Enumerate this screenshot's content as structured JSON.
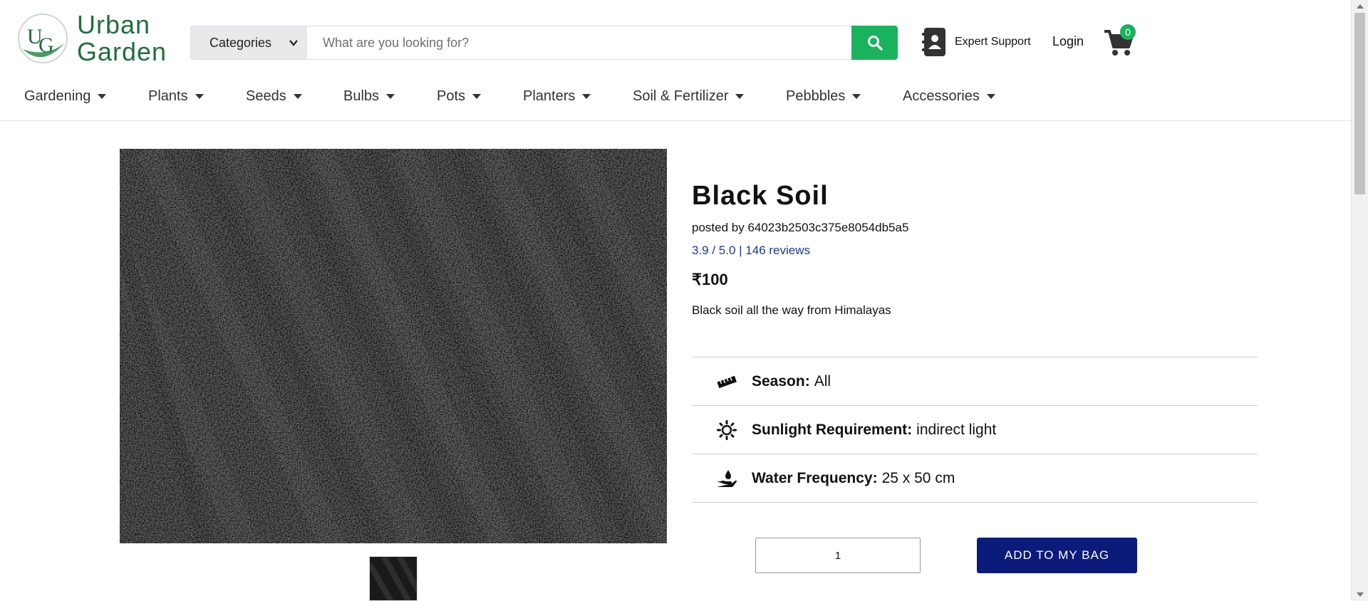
{
  "brand": {
    "line1": "Urban",
    "line2": "Garden",
    "color": "#1f6f3b"
  },
  "search": {
    "category_label": "Categories",
    "placeholder": "What are you looking for?",
    "button_icon": "search-icon",
    "button_color": "#1ab35d"
  },
  "header": {
    "support_label": "Expert Support",
    "login_label": "Login",
    "cart_count": "0"
  },
  "nav": {
    "items": [
      {
        "label": "Gardening"
      },
      {
        "label": "Plants"
      },
      {
        "label": "Seeds"
      },
      {
        "label": "Bulbs"
      },
      {
        "label": "Pots"
      },
      {
        "label": "Planters"
      },
      {
        "label": "Soil & Fertilizer"
      },
      {
        "label": "Pebbbles"
      },
      {
        "label": "Accessories"
      }
    ]
  },
  "product": {
    "title": "Black Soil",
    "posted_by": "posted by 64023b2503c375e8054db5a5",
    "rating_text": "3.9 / 5.0 | 146 reviews",
    "price": "₹100",
    "description": "Black soil all the way from Himalayas",
    "specs": [
      {
        "label": "Season:",
        "value": "All",
        "icon": "ruler-icon"
      },
      {
        "label": "Sunlight Requirement:",
        "value": "indirect light",
        "icon": "sun-icon"
      },
      {
        "label": "Water Frequency:",
        "value": "25 x 50 cm",
        "icon": "hand-water-icon"
      }
    ],
    "quantity": "1",
    "add_to_bag_label": "ADD TO MY BAG",
    "button_color": "#0a1b7a"
  }
}
